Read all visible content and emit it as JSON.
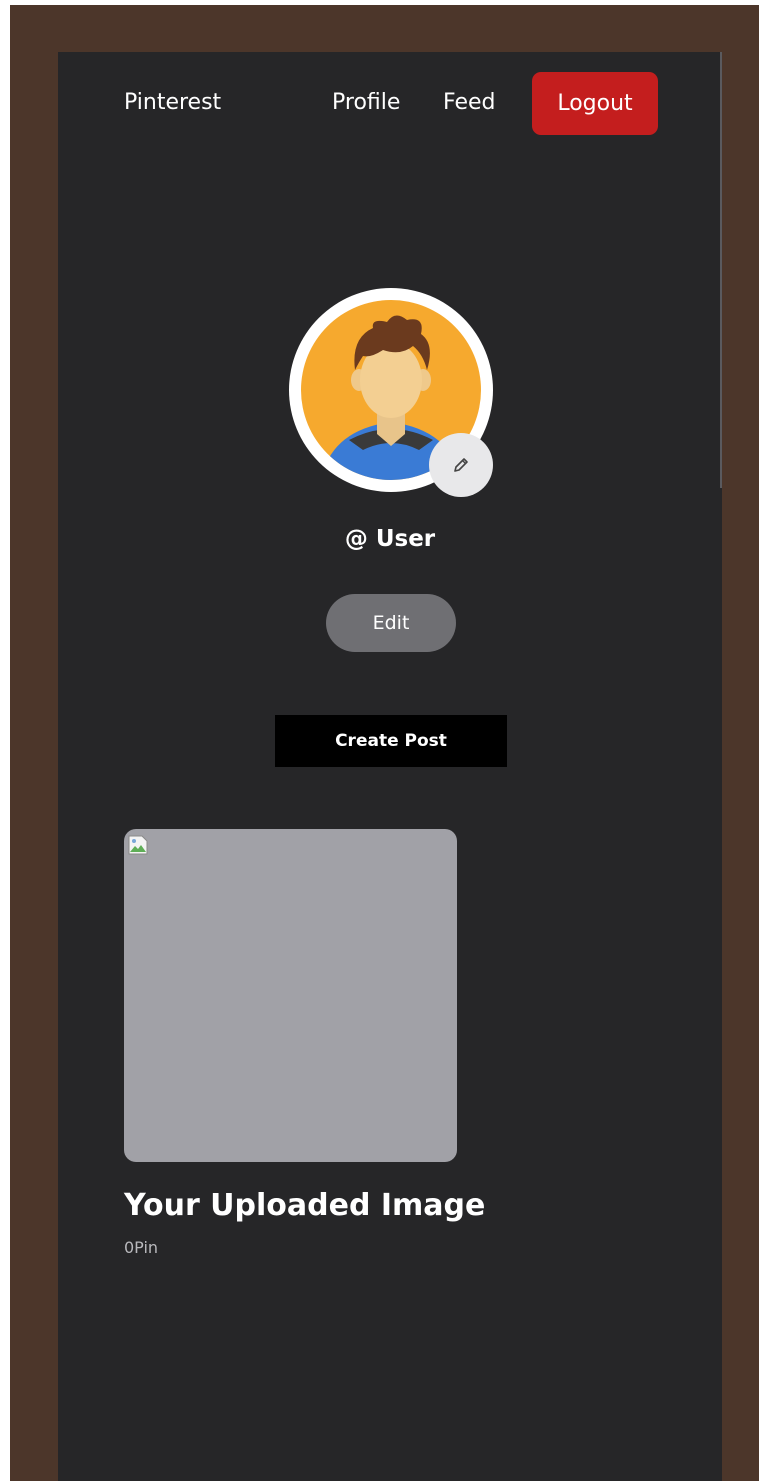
{
  "nav": {
    "brand": "Pinterest",
    "profile": "Profile",
    "feed": "Feed",
    "logout": "Logout"
  },
  "profile": {
    "username": "@ User",
    "edit_label": "Edit",
    "avatar_icon": "user-avatar-icon",
    "edit_avatar_icon": "pencil-icon"
  },
  "actions": {
    "create_post": "Create Post"
  },
  "posts": [
    {
      "title": "Your Uploaded Image",
      "pins": "0Pin"
    }
  ],
  "colors": {
    "frame": "#4c362a",
    "app_background": "#262628",
    "logout": "#c41e1e",
    "edit_button": "#6f6f73",
    "create_post": "#000000",
    "image_placeholder": "#a1a1a7",
    "avatar_background": "#f6a92e"
  }
}
